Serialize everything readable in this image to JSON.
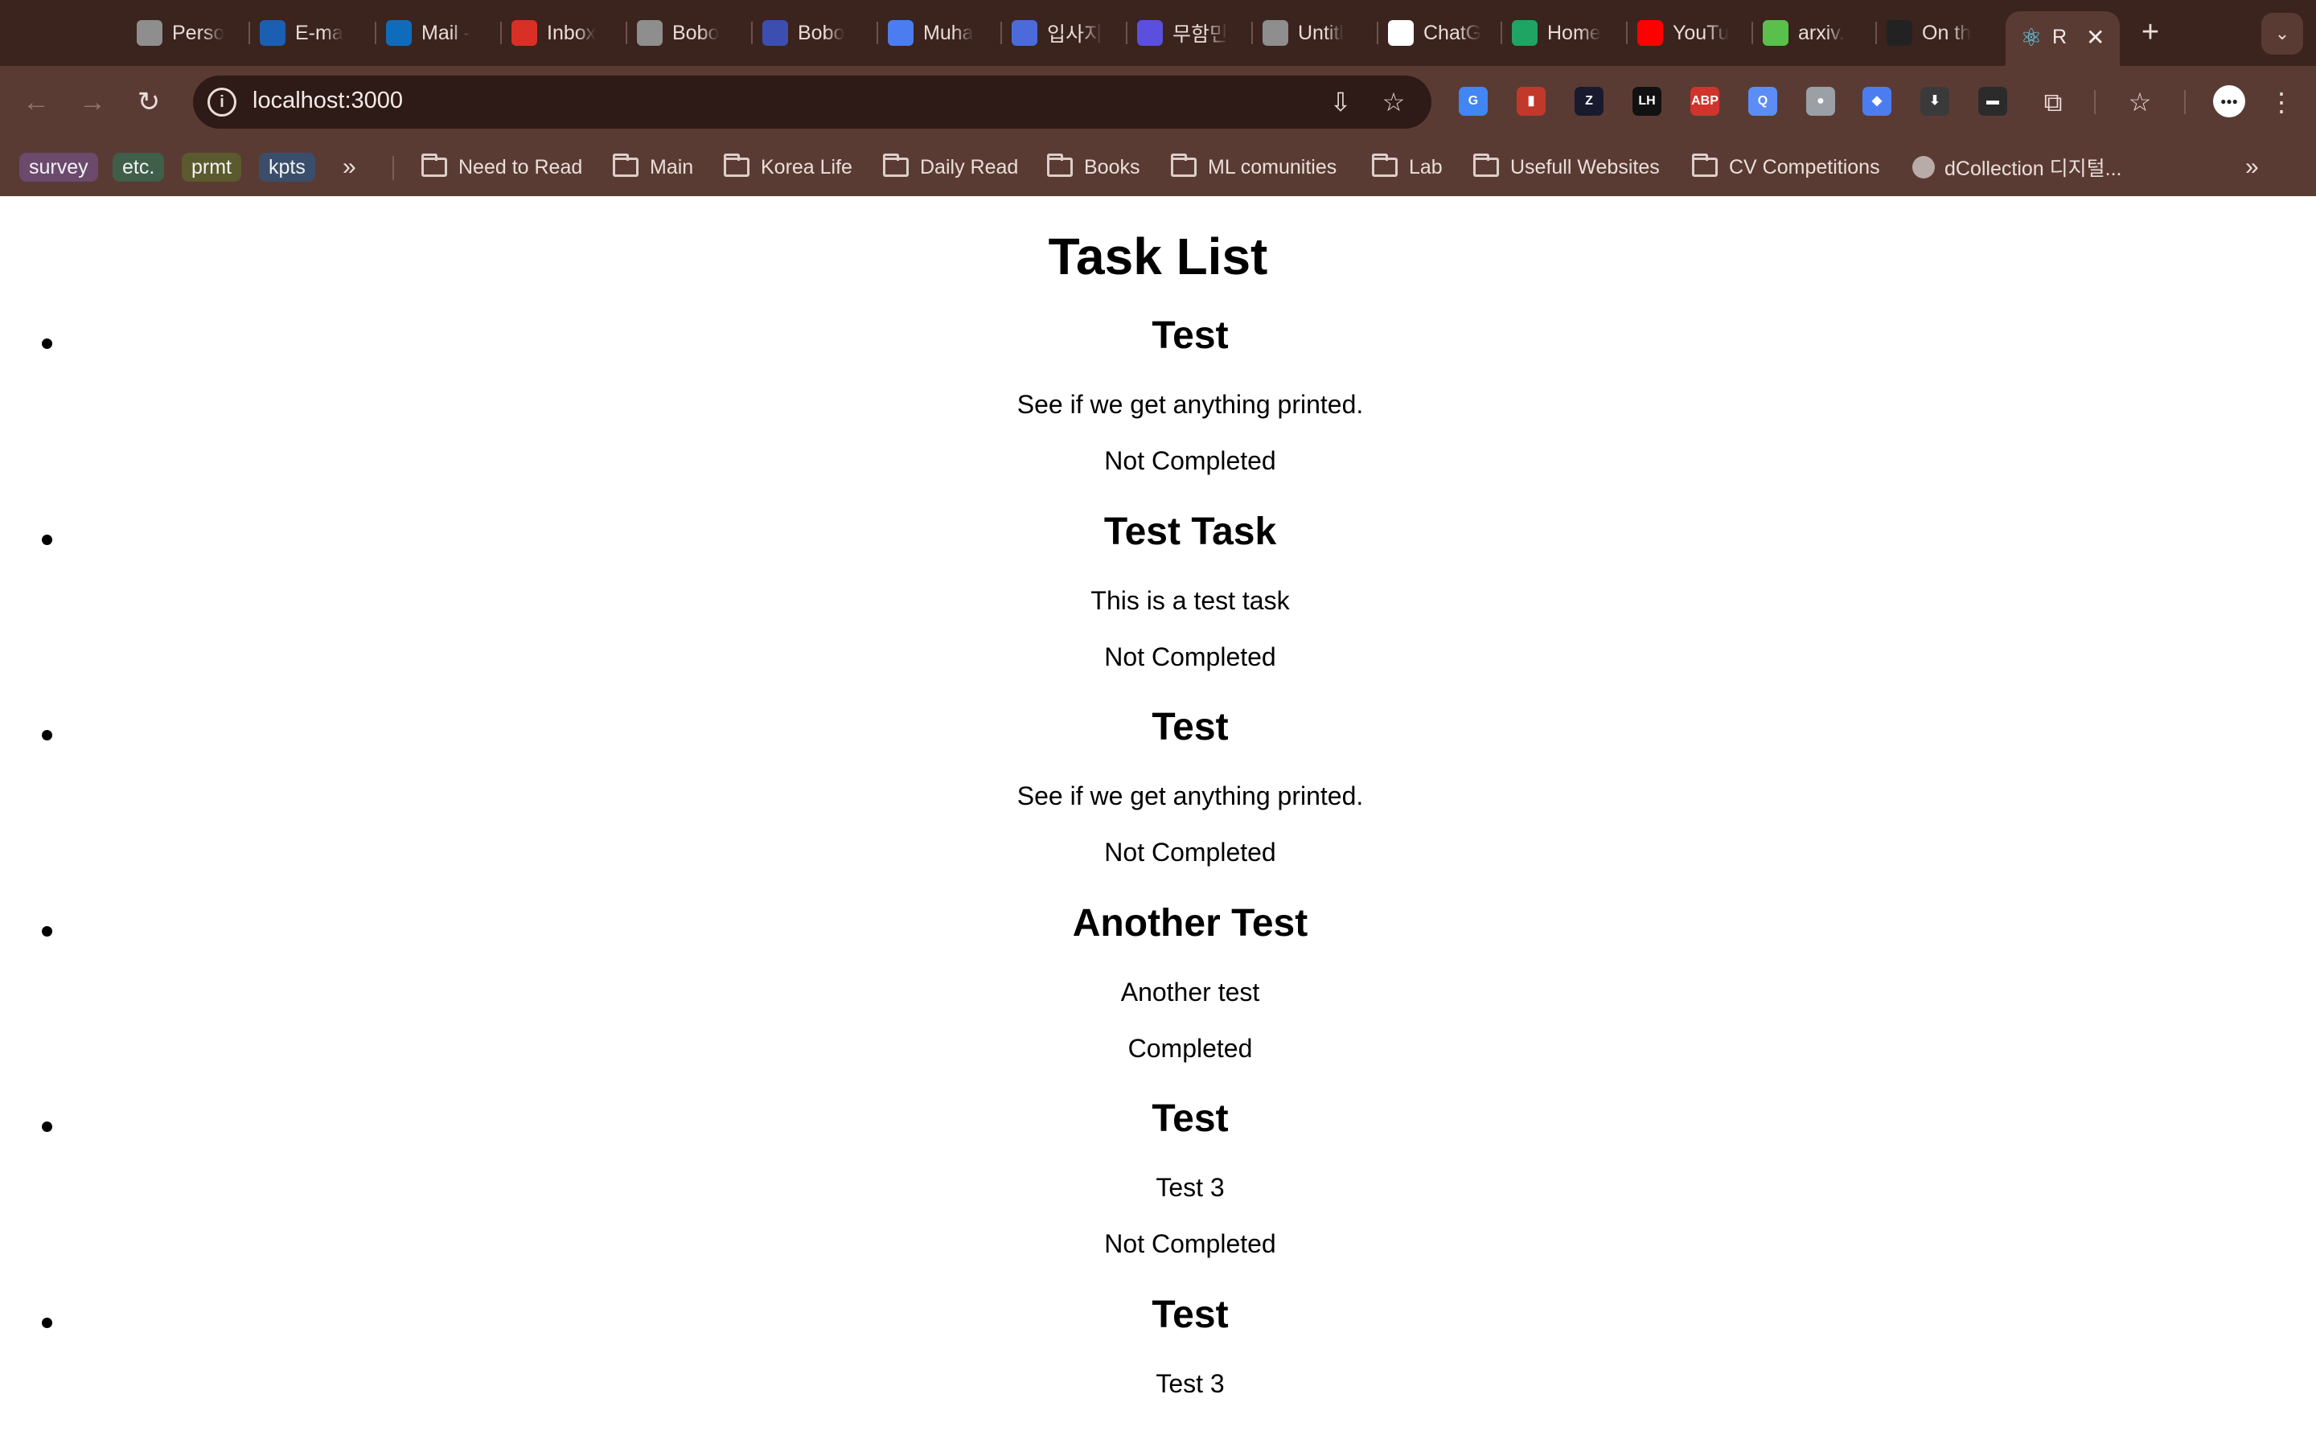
{
  "browser": {
    "tabs": [
      {
        "label": "Perso",
        "icon": "person-icon",
        "color": "#8e8e8e"
      },
      {
        "label": "E-ma",
        "icon": "sap-icon",
        "color": "#1b5fb3"
      },
      {
        "label": "Mail -",
        "icon": "outlook-icon",
        "color": "#0f6cbd"
      },
      {
        "label": "Inbox",
        "icon": "gmail-icon",
        "color": "#d93025"
      },
      {
        "label": "Bobo",
        "icon": "globe-icon",
        "color": "#8e8e8e"
      },
      {
        "label": "Bobo",
        "icon": "forms-icon",
        "color": "#3c4fb1"
      },
      {
        "label": "Muha",
        "icon": "graduation-icon",
        "color": "#4c7df0"
      },
      {
        "label": "입사지",
        "icon": "s-icon",
        "color": "#4b6bdb"
      },
      {
        "label": "무함민",
        "icon": "q-icon",
        "color": "#5b4fe0"
      },
      {
        "label": "Untitl",
        "icon": "globe-icon",
        "color": "#8e8e8e"
      },
      {
        "label": "ChatG",
        "icon": "openai-icon",
        "color": "#ffffff"
      },
      {
        "label": "Home",
        "icon": "drive-icon",
        "color": "#1fa463"
      },
      {
        "label": "YouTu",
        "icon": "youtube-icon",
        "color": "#ff0000"
      },
      {
        "label": "arxiv.",
        "icon": "smiley-icon",
        "color": "#59c04b"
      },
      {
        "label": "On th",
        "icon": "mortarboard-icon",
        "color": "#222222"
      }
    ],
    "active_tab": {
      "label": "R",
      "icon": "react-icon"
    },
    "new_tab_symbol": "+",
    "tab_search_symbol": "⌄",
    "url": "localhost:3000",
    "bookmark_chips": [
      {
        "label": "survey",
        "color": "#6b4a6e"
      },
      {
        "label": "etc.",
        "color": "#3f5f4a"
      },
      {
        "label": "prmt",
        "color": "#5b5a2e"
      },
      {
        "label": "kpts",
        "color": "#3a4e6b"
      }
    ],
    "bookmark_overflow": "»",
    "bookmark_folders": [
      "Need to Read",
      "Main",
      "Korea Life",
      "Daily Read",
      "Books",
      "ML comunities",
      "Lab",
      "Usefull Websites",
      "CV Competitions"
    ],
    "bookmark_site": "dCollection 디지털...",
    "extensions": [
      {
        "name": "translate-extension-icon",
        "text": "G",
        "color": "#4285f4"
      },
      {
        "name": "pdf-extension-icon",
        "text": "▮",
        "color": "#c0392b"
      },
      {
        "name": "zotero-extension-icon",
        "text": "Z",
        "color": "#1a1a2e"
      },
      {
        "name": "lh-extension-icon",
        "text": "LH",
        "color": "#111111"
      },
      {
        "name": "adblock-extension-icon",
        "text": "ABP",
        "color": "#d0342c"
      },
      {
        "name": "search-extension-icon",
        "text": "Q",
        "color": "#5c8df6"
      },
      {
        "name": "contact-extension-icon",
        "text": "●",
        "color": "#9aa0a6"
      },
      {
        "name": "scholar-extension-icon",
        "text": "◆",
        "color": "#4c7df0"
      },
      {
        "name": "download-extension-icon",
        "text": "⬇",
        "color": "#3a3a3a"
      },
      {
        "name": "hat-extension-icon",
        "text": "▬",
        "color": "#2b2b2b"
      }
    ]
  },
  "page": {
    "title": "Task List",
    "tasks": [
      {
        "title": "Test",
        "description": "See if we get anything printed.",
        "status": "Not Completed"
      },
      {
        "title": "Test Task",
        "description": "This is a test task",
        "status": "Not Completed"
      },
      {
        "title": "Test",
        "description": "See if we get anything printed.",
        "status": "Not Completed"
      },
      {
        "title": "Another Test",
        "description": "Another test",
        "status": "Completed"
      },
      {
        "title": "Test",
        "description": "Test 3",
        "status": "Not Completed"
      },
      {
        "title": "Test",
        "description": "Test 3",
        "status": ""
      }
    ]
  }
}
